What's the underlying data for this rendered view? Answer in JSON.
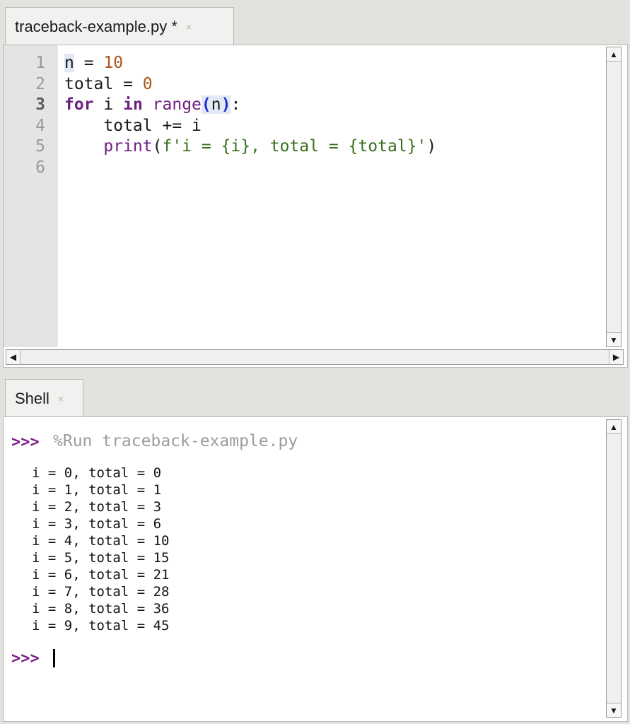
{
  "editor": {
    "tab_label": "traceback-example.py *",
    "close_glyph": "×",
    "line_numbers": [
      "1",
      "2",
      "3",
      "4",
      "5",
      "6"
    ],
    "code": {
      "l1_var": "n",
      "l1_op": " = ",
      "l1_num": "10",
      "l2_var": "total",
      "l2_op": " = ",
      "l2_num": "0",
      "l3_for": "for",
      "l3_i": " i ",
      "l3_in": "in",
      "l3_sp": " ",
      "l3_range": "range",
      "l3_po": "(",
      "l3_n": "n",
      "l3_pc": ")",
      "l3_colon": ":",
      "l4_text": "    total += i",
      "l5_indent": "    ",
      "l5_print": "print",
      "l5_po": "(",
      "l5_str": "f'i = {i}, total = {total}'",
      "l5_pc": ")"
    }
  },
  "shell": {
    "tab_label": "Shell",
    "close_glyph": "×",
    "prompt": ">>>",
    "run_command": "%Run traceback-example.py",
    "output": [
      "i = 0, total = 0",
      "i = 1, total = 1",
      "i = 2, total = 3",
      "i = 3, total = 6",
      "i = 4, total = 10",
      "i = 5, total = 15",
      "i = 6, total = 21",
      "i = 7, total = 28",
      "i = 8, total = 36",
      "i = 9, total = 45"
    ]
  },
  "icons": {
    "up_arrow": "▲",
    "down_arrow": "▼",
    "left_arrow": "◀",
    "right_arrow": "▶"
  },
  "colors": {
    "keyword": "#6e2081",
    "number": "#ad5617",
    "string": "#37701d",
    "paren_match": "#1b2fd8",
    "prompt": "#7a1f86"
  }
}
